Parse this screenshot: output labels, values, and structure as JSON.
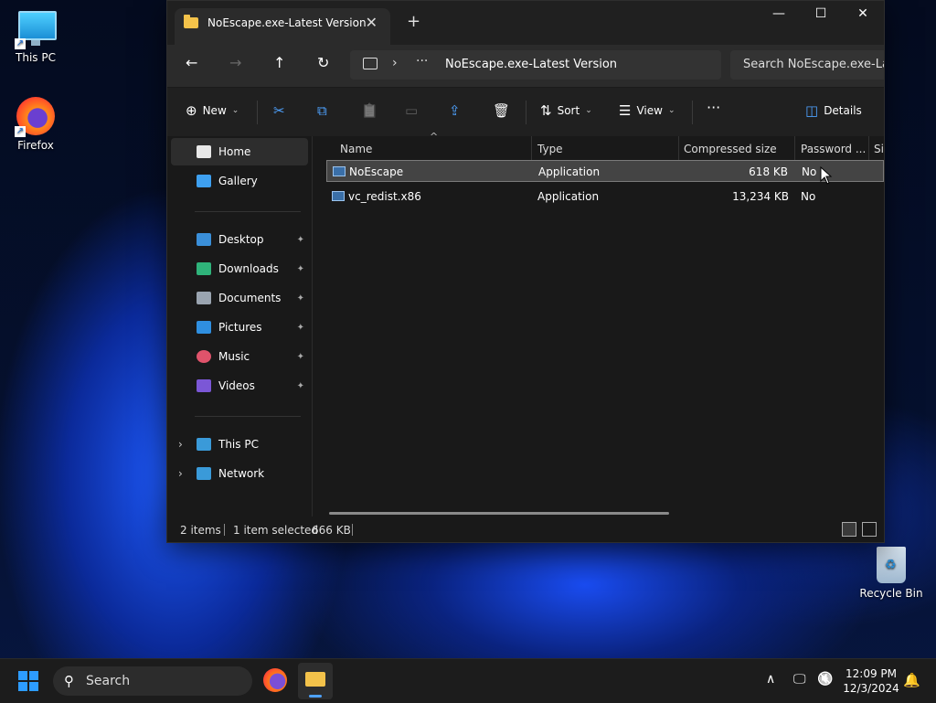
{
  "desktop": {
    "icons": [
      {
        "label": "This PC"
      },
      {
        "label": "Firefox"
      },
      {
        "label": "Recycle Bin"
      }
    ]
  },
  "window": {
    "tab_title": "NoEscape.exe-Latest Version",
    "tab_close": "✕",
    "new_tab": "+",
    "controls": {
      "minimize": "—",
      "maximize": "☐",
      "close": "✕"
    }
  },
  "nav": {
    "back": "←",
    "forward": "→",
    "up": "↑",
    "refresh": "↻",
    "breadcrumb_chevron": "›",
    "breadcrumb_more": "···",
    "path": "NoEscape.exe-Latest Version",
    "search_placeholder": "Search NoEscape.exe-Latest Version"
  },
  "toolbar": {
    "new_label": "New",
    "sort_label": "Sort",
    "view_label": "View",
    "more_label": "···",
    "details_label": "Details",
    "icons": {
      "new": "⊕",
      "cut": "✂",
      "copy": "⧉",
      "paste": "📋",
      "rename": "▭",
      "share": "⇪",
      "delete": "🗑",
      "sort": "⇅",
      "view": "☰",
      "details": "◫"
    }
  },
  "sidebar": {
    "items": [
      {
        "label": "Home",
        "pinned": false,
        "color": "#e8e8e8"
      },
      {
        "label": "Gallery",
        "pinned": false,
        "color": "#3ea0f0"
      },
      {
        "label": "Desktop",
        "pinned": true,
        "color": "#3a8fd9"
      },
      {
        "label": "Downloads",
        "pinned": true,
        "color": "#2fb37a"
      },
      {
        "label": "Documents",
        "pinned": true,
        "color": "#9aa4b0"
      },
      {
        "label": "Pictures",
        "pinned": true,
        "color": "#2f8fe0"
      },
      {
        "label": "Music",
        "pinned": true,
        "color": "#e0536b"
      },
      {
        "label": "Videos",
        "pinned": true,
        "color": "#7b57d6"
      },
      {
        "label": "This PC",
        "expandable": true,
        "color": "#3a9ad9"
      },
      {
        "label": "Network",
        "expandable": true,
        "color": "#3a9ad9"
      }
    ],
    "pin_glyph": "📌",
    "expand_glyph": "›"
  },
  "file_list": {
    "columns": [
      "Name",
      "Type",
      "Compressed size",
      "Password ...",
      "Si"
    ],
    "sort_indicator": "^",
    "rows": [
      {
        "name": "NoEscape",
        "type": "Application",
        "compressed_size": "618 KB",
        "password": "No",
        "selected": true
      },
      {
        "name": "vc_redist.x86",
        "type": "Application",
        "compressed_size": "13,234 KB",
        "password": "No",
        "selected": false
      }
    ]
  },
  "status": {
    "item_count": "2 items",
    "selection": "1 item selected",
    "selection_size": "666 KB"
  },
  "taskbar": {
    "search_label": "Search",
    "search_glyph": "⚲",
    "tray_chevron": "∧",
    "tray_network": "🖵",
    "tray_volume": "🔇",
    "time": "12:09 PM",
    "date": "12/3/2024",
    "bell": "🔔"
  }
}
